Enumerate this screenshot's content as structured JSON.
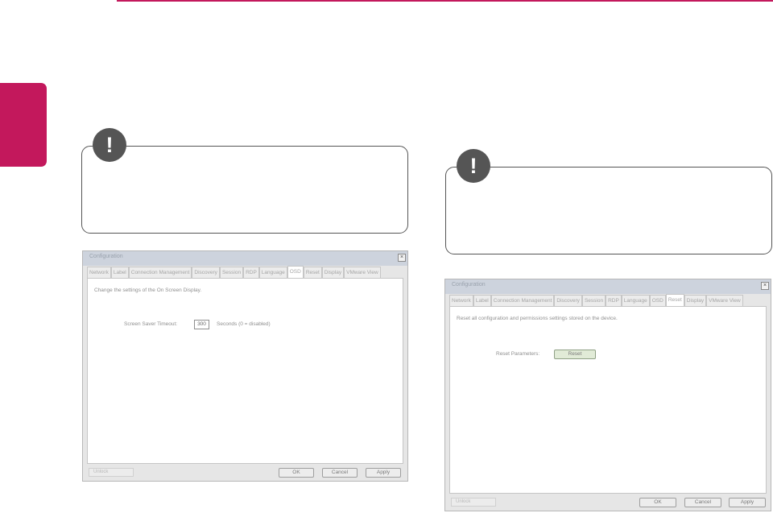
{
  "note_icon_glyph": "!",
  "dialogs": {
    "left": {
      "title": "Configuration",
      "close_glyph": "×",
      "tabs": [
        "Network",
        "Label",
        "Connection Management",
        "Discovery",
        "Session",
        "RDP",
        "Language",
        "OSD",
        "Reset",
        "Display",
        "VMware View"
      ],
      "active_tab": "OSD",
      "description": "Change the settings of the On Screen Display.",
      "field_label": "Screen Saver Timeout:",
      "field_value": "300",
      "field_suffix": "Seconds (0 = disabled)",
      "unlock": "Unlock",
      "ok": "OK",
      "cancel": "Cancel",
      "apply": "Apply"
    },
    "right": {
      "title": "Configuration",
      "close_glyph": "×",
      "tabs": [
        "Network",
        "Label",
        "Connection Management",
        "Discovery",
        "Session",
        "RDP",
        "Language",
        "OSD",
        "Reset",
        "Display",
        "VMware View"
      ],
      "active_tab": "Reset",
      "description": "Reset all configuration and permissions settings stored on the device.",
      "field_label": "Reset Parameters:",
      "reset_button": "Reset",
      "unlock": "Unlock",
      "ok": "OK",
      "cancel": "Cancel",
      "apply": "Apply"
    }
  },
  "colors": {
    "accent": "#c3185c",
    "note_border": "#555555",
    "dialog_title_bar": "#cdd3dd"
  }
}
